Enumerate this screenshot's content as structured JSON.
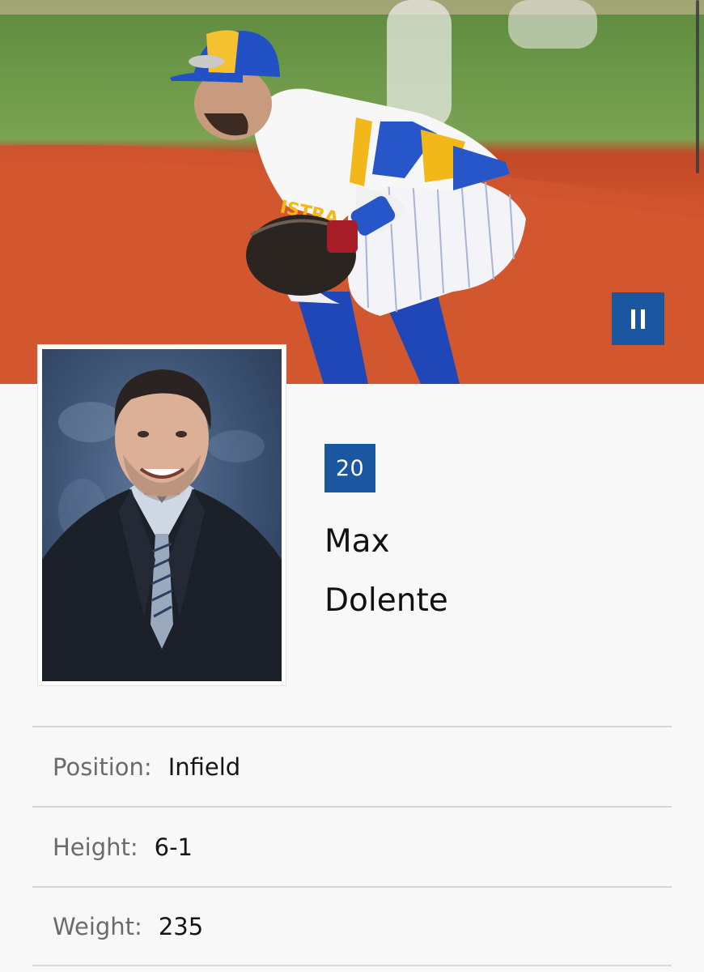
{
  "player": {
    "number": "20",
    "first_name": "Max",
    "last_name": "Dolente"
  },
  "details": [
    {
      "label": "Position:",
      "value": "Infield"
    },
    {
      "label": "Height:",
      "value": "6-1"
    },
    {
      "label": "Weight:",
      "value": "235"
    }
  ],
  "controls": {
    "pause_icon": "pause-icon"
  },
  "colors": {
    "accent": "#1a57a0",
    "background": "#f8f8f9",
    "divider": "#d6d6d6"
  }
}
